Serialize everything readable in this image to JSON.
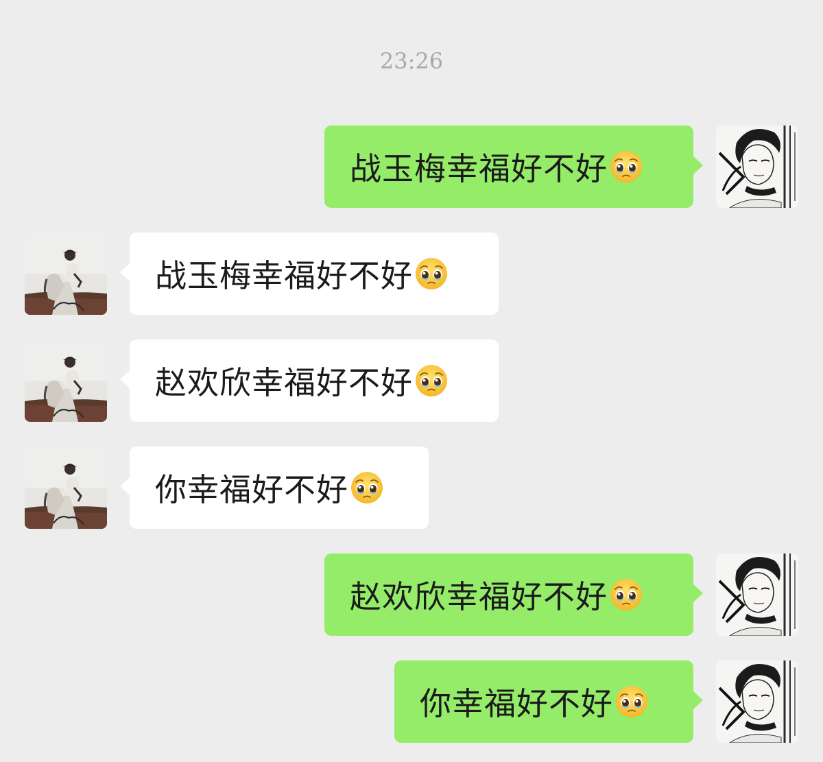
{
  "chat": {
    "timestamp": "23:26",
    "messages": [
      {
        "side": "right",
        "sender": "me",
        "text": "战玉梅幸福好不好",
        "emoji": "pleading-face-emoji"
      },
      {
        "side": "left",
        "sender": "other",
        "text": "战玉梅幸福好不好",
        "emoji": "pleading-face-emoji"
      },
      {
        "side": "left",
        "sender": "other",
        "text": "赵欢欣幸福好不好",
        "emoji": "pleading-face-emoji"
      },
      {
        "side": "left",
        "sender": "other",
        "text": "你幸福好不好",
        "emoji": "pleading-face-emoji"
      },
      {
        "side": "right",
        "sender": "me",
        "text": "赵欢欣幸福好不好",
        "emoji": "pleading-face-emoji"
      },
      {
        "side": "right",
        "sender": "me",
        "text": "你幸福好不好",
        "emoji": "pleading-face-emoji"
      }
    ]
  },
  "colors": {
    "background": "#ededed",
    "sent_bubble": "#95ec69",
    "received_bubble": "#ffffff",
    "timestamp_text": "#a8a8a8"
  }
}
